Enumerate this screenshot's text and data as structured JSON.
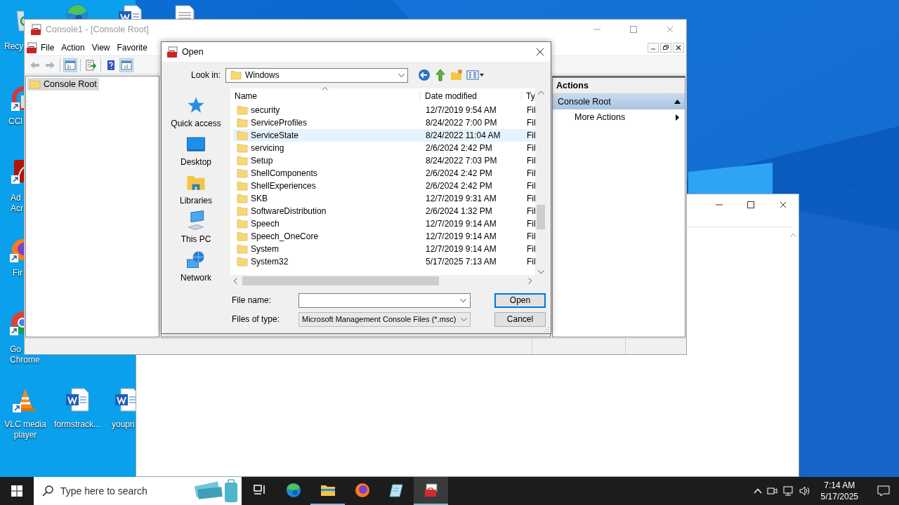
{
  "desktop": {
    "icons": [
      {
        "kind": "recycle-bin",
        "label": [
          "Recy"
        ]
      },
      {
        "kind": "edge"
      },
      {
        "kind": "word-document"
      },
      {
        "kind": "document"
      },
      {
        "kind": "ccleaner",
        "label": [
          "CCl"
        ]
      },
      {
        "kind": "acrobat",
        "label": [
          "Ad",
          "Acr"
        ]
      },
      {
        "kind": "firefox",
        "label": [
          "Fir"
        ]
      },
      {
        "kind": "chrome",
        "label": [
          "Go",
          "Chrome"
        ]
      },
      {
        "kind": "vlc",
        "label": [
          "VLC media",
          "player"
        ]
      },
      {
        "kind": "word-document",
        "label": [
          "formstrack..."
        ]
      },
      {
        "kind": "word-document",
        "label": [
          "youpn"
        ]
      }
    ]
  },
  "console": {
    "title": "Console1 - [Console Root]",
    "active": false,
    "menu": [
      "File",
      "Action",
      "View",
      "Favorite"
    ],
    "toolbar": [
      {
        "kind": "back",
        "disabled": true,
        "pressed": false
      },
      {
        "kind": "forward",
        "disabled": true,
        "pressed": false
      },
      {
        "kind": "separator"
      },
      {
        "kind": "tree-pane",
        "disabled": false,
        "pressed": true
      },
      {
        "kind": "separator"
      },
      {
        "kind": "export",
        "disabled": false,
        "pressed": false
      },
      {
        "kind": "separator"
      },
      {
        "kind": "help",
        "disabled": false,
        "pressed": false
      },
      {
        "kind": "action-pane",
        "disabled": false,
        "pressed": true
      }
    ],
    "tree": [
      {
        "label": "Console Root",
        "selected": true
      }
    ],
    "actions": {
      "title": "Actions",
      "sections": [
        {
          "label": "Console Root",
          "expanded": true,
          "items": [
            {
              "label": "More Actions"
            }
          ]
        }
      ]
    }
  },
  "open_dialog": {
    "title": "Open",
    "look_in": {
      "label": "Look in:",
      "value": "Windows"
    },
    "places": [
      {
        "kind": "quick-access",
        "label": "Quick access"
      },
      {
        "kind": "desktop",
        "label": "Desktop"
      },
      {
        "kind": "libraries",
        "label": "Libraries"
      },
      {
        "kind": "this-pc",
        "label": "This PC"
      },
      {
        "kind": "network",
        "label": "Network"
      }
    ],
    "columns": [
      "Name",
      "Date modified",
      "Ty"
    ],
    "rows": [
      {
        "name": "security",
        "date": "12/7/2019 9:54 AM",
        "type": "Fil",
        "hovered": false
      },
      {
        "name": "ServiceProfiles",
        "date": "8/24/2022 7:00 PM",
        "type": "Fil",
        "hovered": false
      },
      {
        "name": "ServiceState",
        "date": "8/24/2022 11:04 AM",
        "type": "Fil",
        "hovered": true
      },
      {
        "name": "servicing",
        "date": "2/6/2024 2:42 PM",
        "type": "Fil",
        "hovered": false
      },
      {
        "name": "Setup",
        "date": "8/24/2022 7:03 PM",
        "type": "Fil",
        "hovered": false
      },
      {
        "name": "ShellComponents",
        "date": "2/6/2024 2:42 PM",
        "type": "Fil",
        "hovered": false
      },
      {
        "name": "ShellExperiences",
        "date": "2/6/2024 2:42 PM",
        "type": "Fil",
        "hovered": false
      },
      {
        "name": "SKB",
        "date": "12/7/2019 9:31 AM",
        "type": "Fil",
        "hovered": false
      },
      {
        "name": "SoftwareDistribution",
        "date": "2/6/2024 1:32 PM",
        "type": "Fil",
        "hovered": false
      },
      {
        "name": "Speech",
        "date": "12/7/2019 9:14 AM",
        "type": "Fil",
        "hovered": false
      },
      {
        "name": "Speech_OneCore",
        "date": "12/7/2019 9:14 AM",
        "type": "Fil",
        "hovered": false
      },
      {
        "name": "System",
        "date": "12/7/2019 9:14 AM",
        "type": "Fil",
        "hovered": false
      },
      {
        "name": "System32",
        "date": "5/17/2025 7:13 AM",
        "type": "Fil",
        "hovered": false
      }
    ],
    "file_name": {
      "label": "File name:"
    },
    "file_type": {
      "label": "Files of type:",
      "value": "Microsoft Management Console Files (*.msc)"
    },
    "buttons": [
      {
        "label": "Open",
        "default": true
      },
      {
        "label": "Cancel",
        "default": false
      }
    ]
  },
  "taskbar": {
    "search": {
      "placeholder": "Type here to search"
    },
    "apps": [
      {
        "kind": "task-view",
        "running": false,
        "active": false
      },
      {
        "kind": "edge",
        "running": false,
        "active": false
      },
      {
        "kind": "file-explorer",
        "running": true,
        "active": false
      },
      {
        "kind": "firefox",
        "running": false,
        "active": false
      },
      {
        "kind": "notepad",
        "running": false,
        "active": false
      },
      {
        "kind": "console",
        "running": true,
        "active": true
      }
    ],
    "clock": {
      "time": "7:14 AM",
      "date": "5/17/2025"
    }
  }
}
